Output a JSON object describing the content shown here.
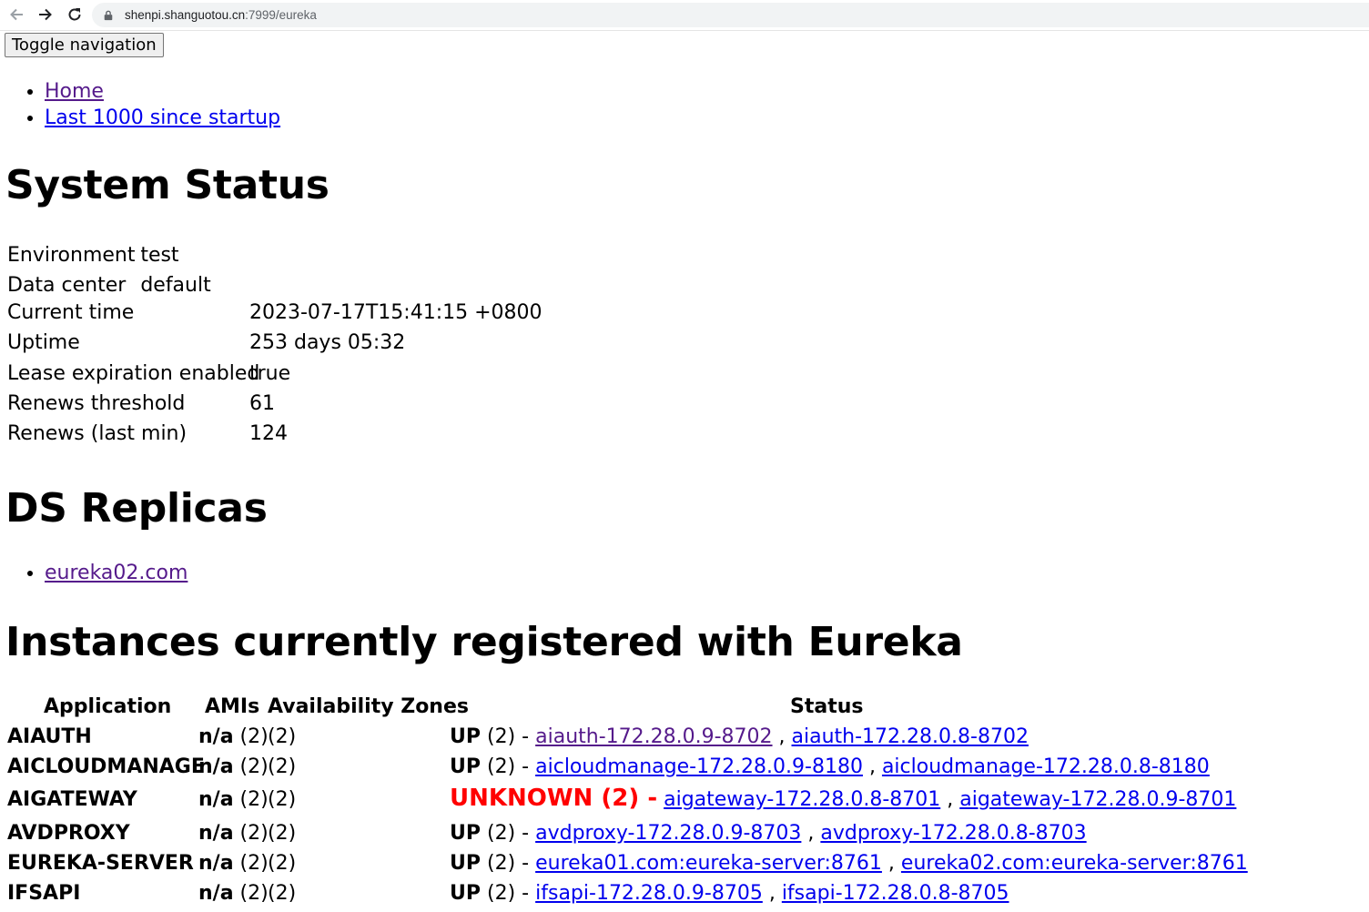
{
  "browser": {
    "url_host": "shenpi.shanguotou.cn",
    "url_path": ":7999/eureka"
  },
  "toggle_label": "Toggle navigation",
  "nav": [
    {
      "label": "Home"
    },
    {
      "label": "Last 1000 since startup"
    }
  ],
  "system_status": {
    "title": "System Status",
    "rows_a": [
      {
        "key": "Environment",
        "value": "test"
      },
      {
        "key": "Data center",
        "value": "default"
      }
    ],
    "rows_b": [
      {
        "key": "Current time",
        "value": "2023-07-17T15:41:15 +0800"
      },
      {
        "key": "Uptime",
        "value": "253 days 05:32"
      },
      {
        "key": "Lease expiration enabled",
        "value": "true"
      },
      {
        "key": "Renews threshold",
        "value": "61"
      },
      {
        "key": "Renews (last min)",
        "value": "124"
      }
    ]
  },
  "replicas": {
    "title": "DS Replicas",
    "items": [
      "eureka02.com"
    ]
  },
  "instances": {
    "title": "Instances currently registered with Eureka",
    "headers": {
      "application": "Application",
      "amis": "AMIs",
      "zones": "Availability Zones",
      "status": "Status"
    },
    "rows": [
      {
        "app": "AIAUTH",
        "ami": "n/a",
        "ami_count": "(2)",
        "zones": "(2)",
        "status": "UP",
        "status_count": "(2)",
        "sep": "-",
        "links": [
          "aiauth-172.28.0.9-8702",
          "aiauth-172.28.0.8-8702"
        ]
      },
      {
        "app": "AICLOUDMANAGE",
        "ami": "n/a",
        "ami_count": "(2)",
        "zones": "(2)",
        "status": "UP",
        "status_count": "(2)",
        "sep": "-",
        "links": [
          "aicloudmanage-172.28.0.9-8180",
          "aicloudmanage-172.28.0.8-8180"
        ]
      },
      {
        "app": "AIGATEWAY",
        "ami": "n/a",
        "ami_count": "(2)",
        "zones": "(2)",
        "status": "UNKNOWN",
        "status_count": "(2)",
        "sep": "-",
        "links": [
          "aigateway-172.28.0.8-8701",
          "aigateway-172.28.0.9-8701"
        ]
      },
      {
        "app": "AVDPROXY",
        "ami": "n/a",
        "ami_count": "(2)",
        "zones": "(2)",
        "status": "UP",
        "status_count": "(2)",
        "sep": "-",
        "links": [
          "avdproxy-172.28.0.9-8703",
          "avdproxy-172.28.0.8-8703"
        ]
      },
      {
        "app": "EUREKA-SERVER",
        "ami": "n/a",
        "ami_count": "(2)",
        "zones": "(2)",
        "status": "UP",
        "status_count": "(2)",
        "sep": "-",
        "links": [
          "eureka01.com:eureka-server:8761",
          "eureka02.com:eureka-server:8761"
        ]
      },
      {
        "app": "IFSAPI",
        "ami": "n/a",
        "ami_count": "(2)",
        "zones": "(2)",
        "status": "UP",
        "status_count": "(2)",
        "sep": "-",
        "links": [
          "ifsapi-172.28.0.9-8705",
          "ifsapi-172.28.0.8-8705"
        ]
      }
    ]
  },
  "colors": {
    "link": "#0000ee",
    "visited": "#551a8b",
    "unknown": "#ff0000"
  },
  "icons": [
    "back-arrow-icon",
    "forward-arrow-icon",
    "reload-icon",
    "lock-icon"
  ]
}
